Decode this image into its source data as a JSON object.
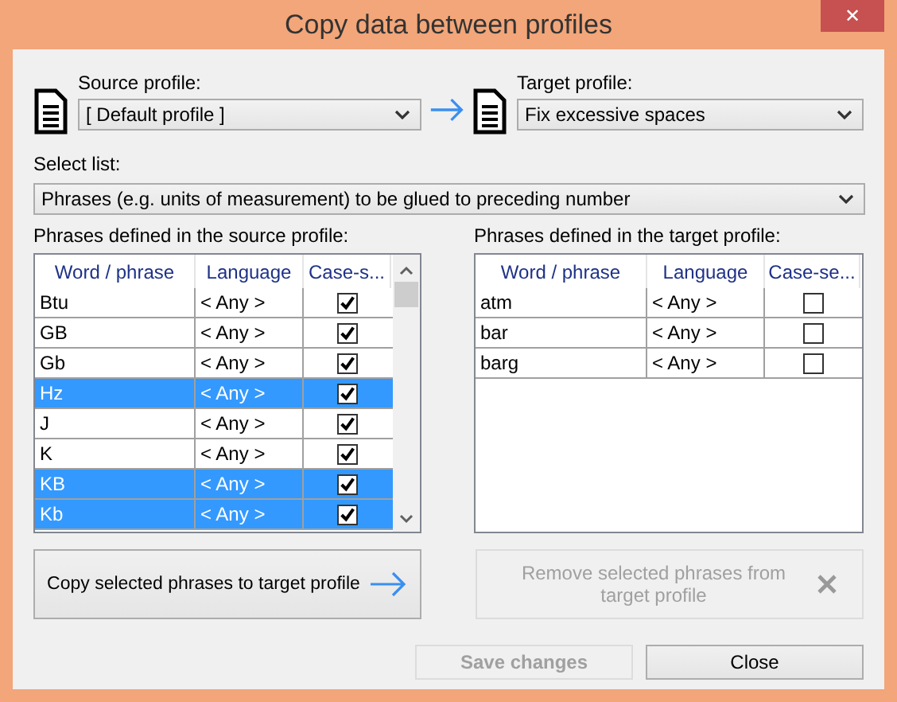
{
  "window": {
    "title": "Copy data between profiles",
    "close": "✕"
  },
  "source": {
    "label": "Source profile:",
    "value": "[ Default profile ]"
  },
  "target": {
    "label": "Target profile:",
    "value": "Fix excessive spaces"
  },
  "select_list": {
    "label": "Select list:",
    "value": "Phrases (e.g. units of measurement) to be glued to preceding number"
  },
  "source_table": {
    "label": "Phrases defined in the source profile:",
    "columns": [
      "Word / phrase",
      "Language",
      "Case-s..."
    ],
    "rows": [
      {
        "phrase": "Btu",
        "language": "< Any >",
        "checked": true,
        "selected": false
      },
      {
        "phrase": "GB",
        "language": "< Any >",
        "checked": true,
        "selected": false
      },
      {
        "phrase": "Gb",
        "language": "< Any >",
        "checked": true,
        "selected": false
      },
      {
        "phrase": "Hz",
        "language": "< Any >",
        "checked": true,
        "selected": true
      },
      {
        "phrase": "J",
        "language": "< Any >",
        "checked": true,
        "selected": false
      },
      {
        "phrase": "K",
        "language": "< Any >",
        "checked": true,
        "selected": false
      },
      {
        "phrase": "KB",
        "language": "< Any >",
        "checked": true,
        "selected": true
      },
      {
        "phrase": "Kb",
        "language": "< Any >",
        "checked": true,
        "selected": true
      }
    ]
  },
  "target_table": {
    "label": "Phrases defined in the target profile:",
    "columns": [
      "Word / phrase",
      "Language",
      "Case-se..."
    ],
    "rows": [
      {
        "phrase": "atm",
        "language": "< Any >",
        "checked": false,
        "selected": false
      },
      {
        "phrase": "bar",
        "language": "< Any >",
        "checked": false,
        "selected": false
      },
      {
        "phrase": "barg",
        "language": "< Any >",
        "checked": false,
        "selected": false
      }
    ]
  },
  "copy_button": {
    "label": "Copy selected phrases to target profile",
    "disabled": false
  },
  "remove_button": {
    "label": "Remove selected phrases from target profile",
    "disabled": true
  },
  "buttons": [
    {
      "label": "Save changes",
      "disabled": true
    },
    {
      "label": "Close",
      "disabled": false
    }
  ]
}
